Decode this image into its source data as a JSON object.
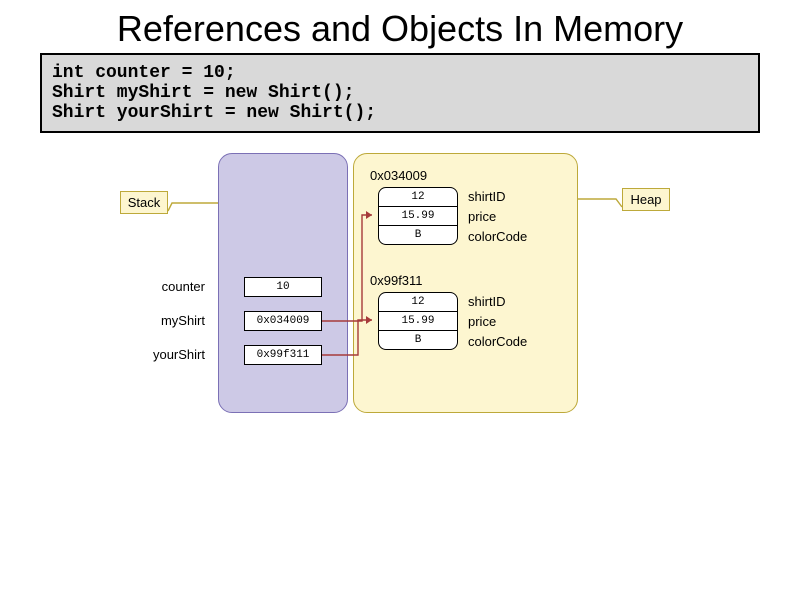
{
  "title": "References and Objects In Memory",
  "code": "int counter = 10;\nShirt myShirt = new Shirt();\nShirt yourShirt = new Shirt();",
  "stack": {
    "label": "Stack",
    "vars": {
      "counter": {
        "name": "counter",
        "value": "10"
      },
      "myShirt": {
        "name": "myShirt",
        "value": "0x034009"
      },
      "yourShirt": {
        "name": "yourShirt",
        "value": "0x99f311"
      }
    }
  },
  "heap": {
    "label": "Heap",
    "obj1": {
      "address": "0x034009",
      "fields": {
        "shirtID": {
          "label": "shirtID",
          "value": "12"
        },
        "price": {
          "label": "price",
          "value": "15.99"
        },
        "colorCode": {
          "label": "colorCode",
          "value": "B"
        }
      }
    },
    "obj2": {
      "address": "0x99f311",
      "fields": {
        "shirtID": {
          "label": "shirtID",
          "value": "12"
        },
        "price": {
          "label": "price",
          "value": "15.99"
        },
        "colorCode": {
          "label": "colorCode",
          "value": "B"
        }
      }
    }
  }
}
